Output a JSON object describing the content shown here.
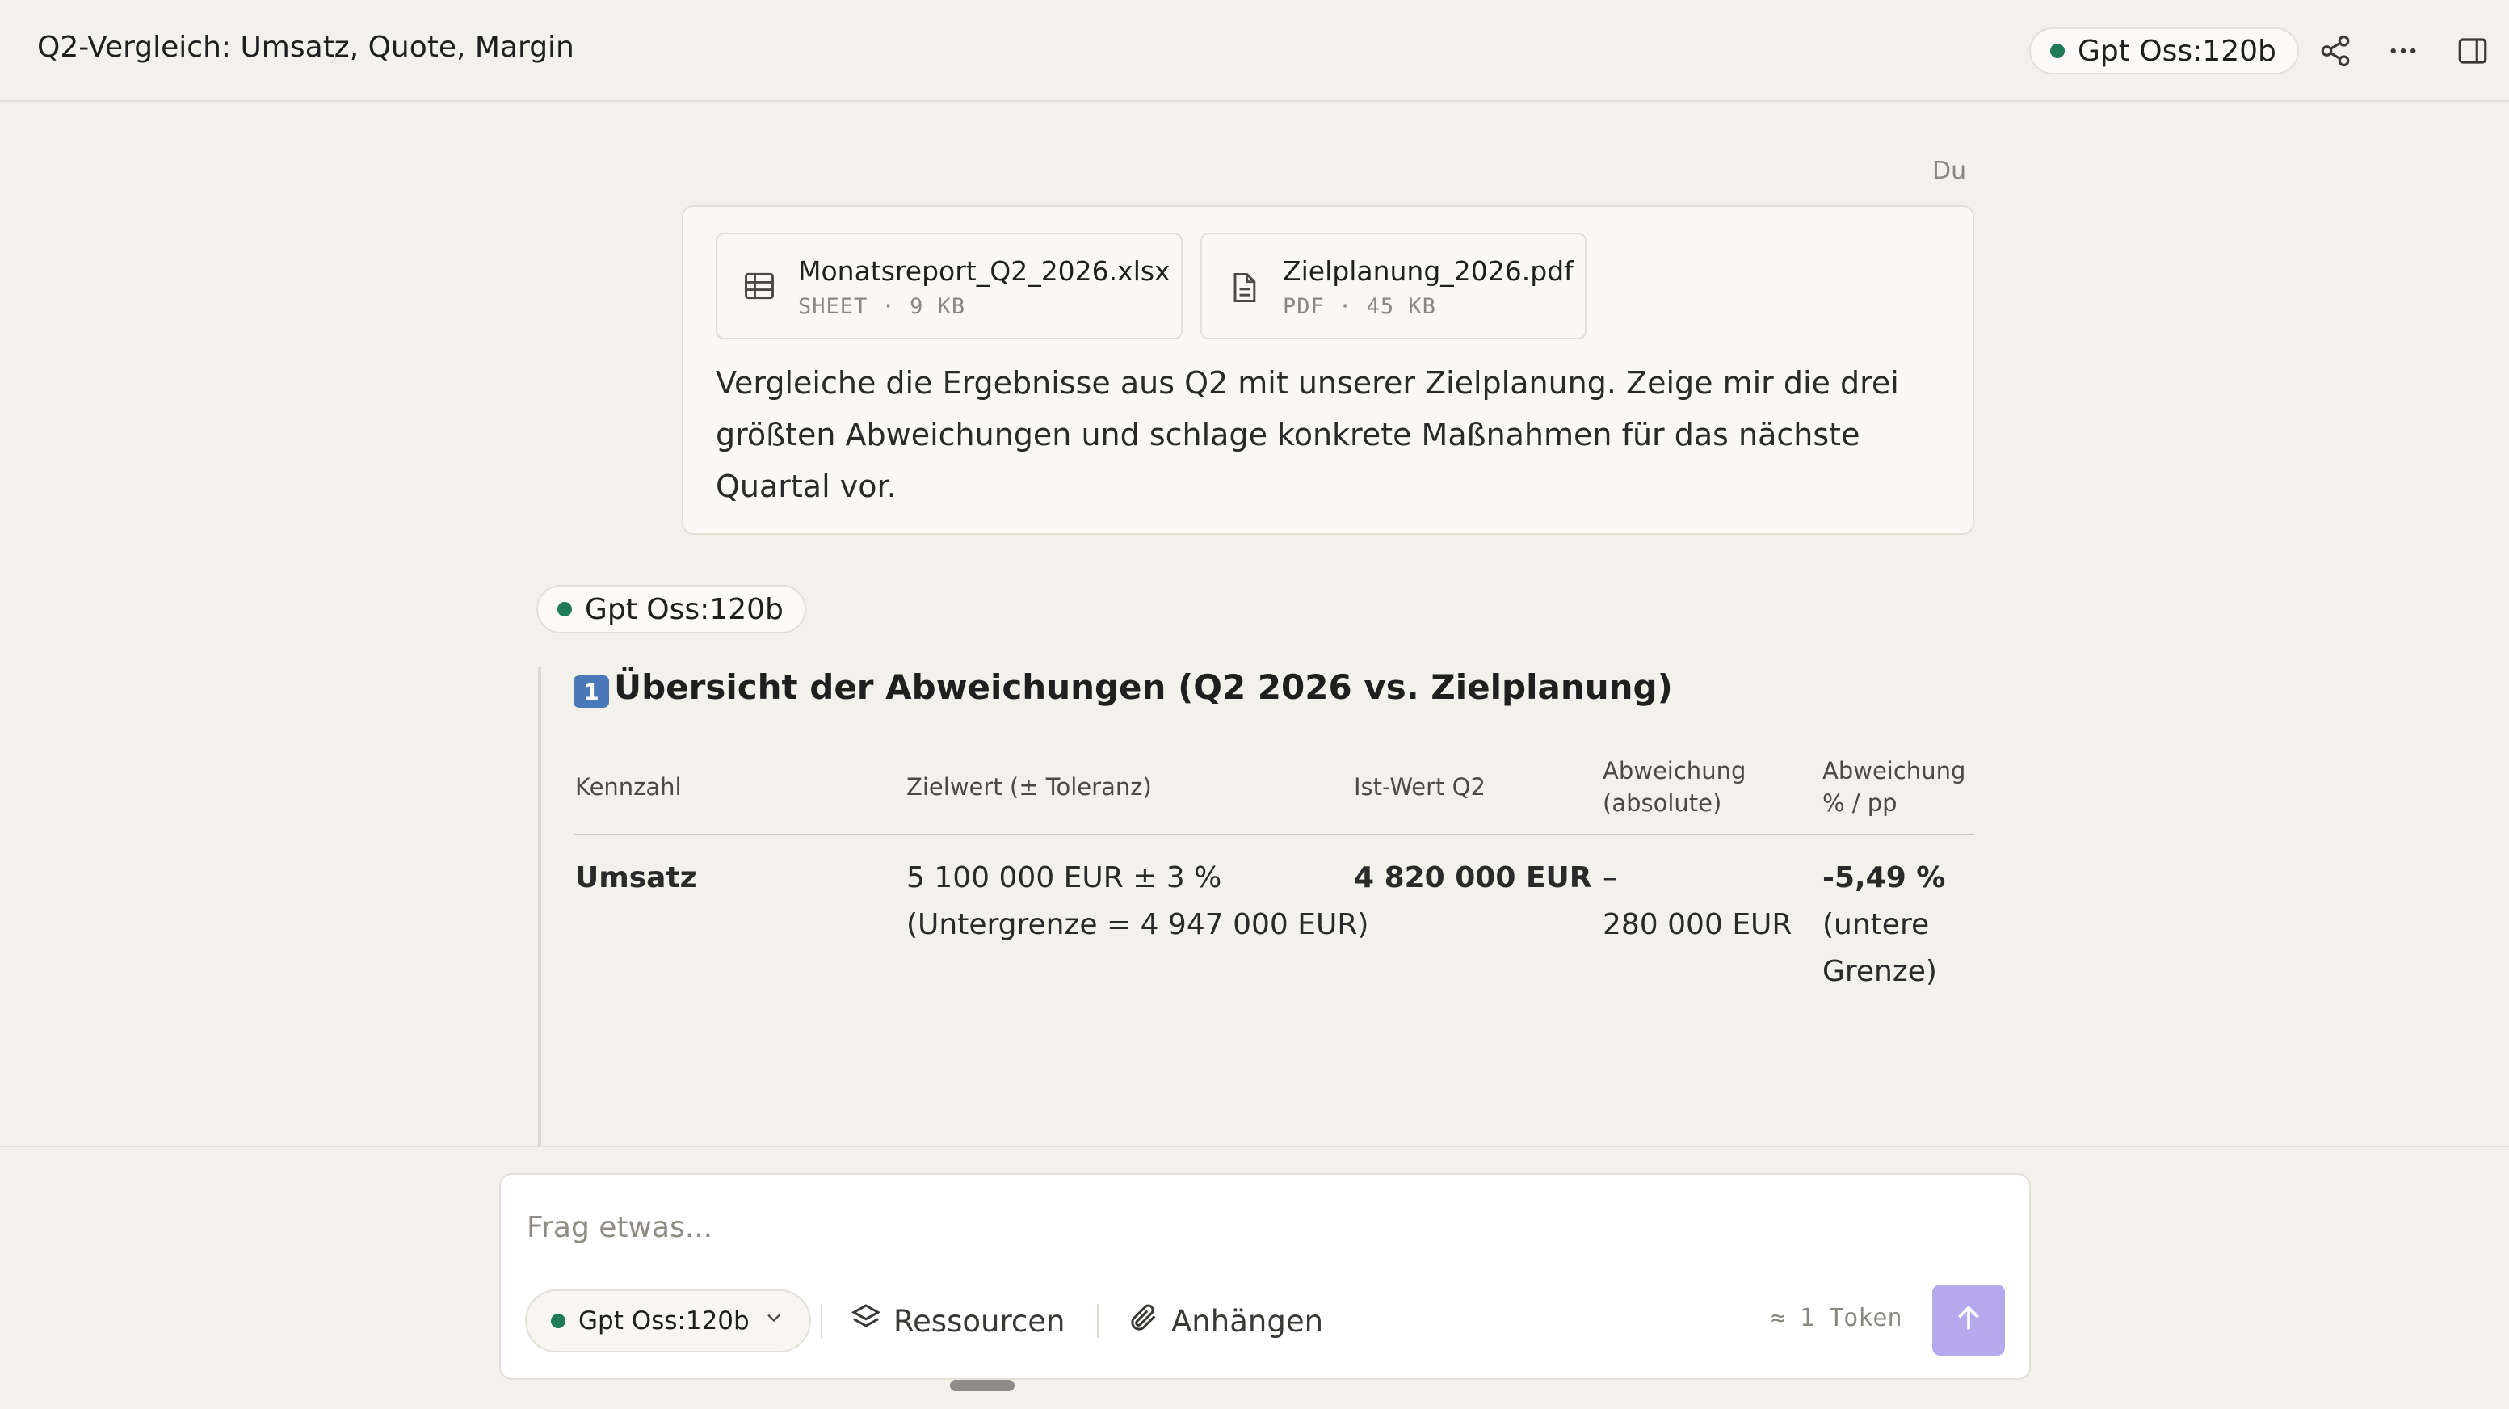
{
  "header": {
    "title": "Q2-Vergleich: Umsatz, Quote, Margin",
    "model_label": "Gpt Oss:120b",
    "status_color": "#1f7a55"
  },
  "conversation": {
    "user_label": "Du",
    "attachments": [
      {
        "name": "Monatsreport_Q2_2026.xlsx",
        "type": "SHEET",
        "size": "9 KB",
        "icon": "table-icon"
      },
      {
        "name": "Zielplanung_2026.pdf",
        "type": "PDF",
        "size": "45 KB",
        "icon": "document-icon"
      }
    ],
    "user_message": "Vergleiche die Ergebnisse aus Q2 mit unserer Zielplanung. Zeige mir die drei größten Abweichungen und schlage konkrete Maßnahmen für das nächste Quartal vor.",
    "assistant_model": "Gpt Oss:120b",
    "answer": {
      "number_badge": "1",
      "heading": "Übersicht der Abweichungen (Q2 2026 vs. Zielplanung)",
      "table": {
        "headers": [
          "Kennzahl",
          "Zielwert (± Toleranz)",
          "Ist-Wert Q2",
          "Abweichung (absolute)",
          "Abweichung % / pp"
        ],
        "rows": [
          {
            "kennzahl": "Umsatz",
            "zielwert": "5 100 000 EUR ± 3 %",
            "zielwert_note": "(Untergrenze = 4 947 000 EUR)",
            "ist": "4 820 000 EUR",
            "abs_sign": "–",
            "abs_value": "280 000 EUR",
            "pct": "-5,49 %",
            "pct_note_1": "(untere",
            "pct_note_2": "Grenze)"
          }
        ]
      }
    }
  },
  "composer": {
    "placeholder": "Frag etwas...",
    "model_select": "Gpt Oss:120b",
    "resources_label": "Ressourcen",
    "attach_label": "Anhängen",
    "token_count": "≈ 1 Token",
    "send_color": "#b5a8ec"
  }
}
